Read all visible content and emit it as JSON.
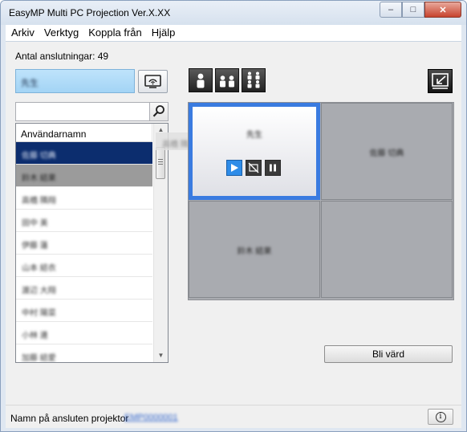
{
  "window": {
    "title": "EasyMP Multi PC Projection Ver.X.XX"
  },
  "menu": [
    "Arkiv",
    "Verktyg",
    "Koppla från",
    "Hjälp"
  ],
  "connections": {
    "label": "Antal anslutningar: 49"
  },
  "current_user": "先生",
  "search": {
    "value": "",
    "placeholder": ""
  },
  "user_list": {
    "header": "Användarnamn",
    "rows": [
      "佐藤 切典",
      "鈴木 結果",
      "高橋 隣翔",
      "田中 美",
      "伊藤 蓮",
      "山本 結衣",
      "渡辺 大翔",
      "中村 陽菜",
      "小林 連",
      "加藤 結愛"
    ],
    "selected_index": 0,
    "highlight_index": 1,
    "drag_item": "高橋 隣翔"
  },
  "projection_grid": {
    "cells": [
      {
        "label": "先生",
        "active": true
      },
      {
        "label": "佐藤 切典",
        "active": false
      },
      {
        "label": "鈴木 結果",
        "active": false
      },
      {
        "label": "",
        "active": false
      }
    ]
  },
  "buttons": {
    "host": "Bli värd"
  },
  "icons": {
    "cast": "wifi-display-icon",
    "search": "magnifier-icon",
    "layout1": "single-person-icon",
    "layout2": "two-person-icon",
    "layout4": "four-person-icon",
    "fullscreen": "exit-fullscreen-icon",
    "play": "play-icon",
    "blank": "no-display-icon",
    "pause": "pause-icon",
    "info": "info-icon"
  },
  "status": {
    "label": "Namn på ansluten projektor",
    "projector": "EMP0000001"
  },
  "colors": {
    "accent": "#3a7be0",
    "selection": "#0c2d6e",
    "user_box": "#a3d4f5"
  }
}
